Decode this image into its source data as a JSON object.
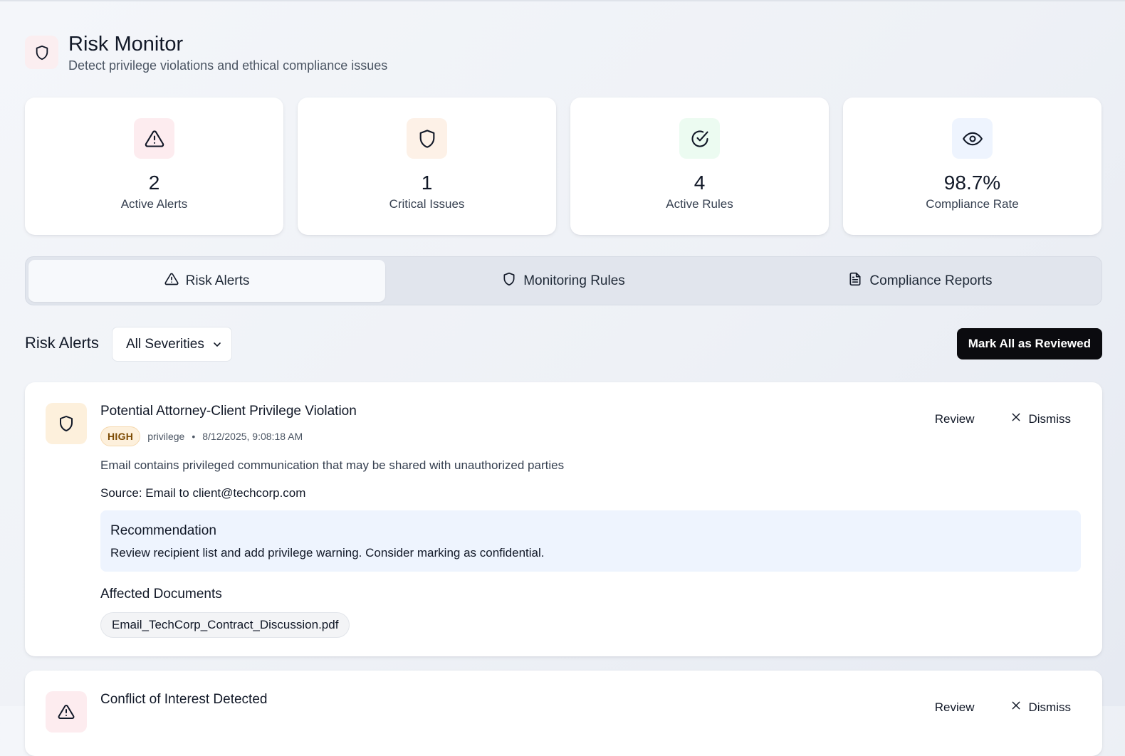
{
  "header": {
    "title": "Risk Monitor",
    "subtitle": "Detect privilege violations and ethical compliance issues",
    "icon": "shield-icon"
  },
  "stats": [
    {
      "value": "2",
      "label": "Active Alerts",
      "icon": "alert-triangle-icon",
      "bg": "#fdecef"
    },
    {
      "value": "1",
      "label": "Critical Issues",
      "icon": "shield-icon",
      "bg": "#fdf1e7"
    },
    {
      "value": "4",
      "label": "Active Rules",
      "icon": "check-circle-icon",
      "bg": "#ecfbf1"
    },
    {
      "value": "98.7%",
      "label": "Compliance Rate",
      "icon": "eye-icon",
      "bg": "#eef4fe"
    }
  ],
  "tabs": [
    {
      "label": "Risk Alerts",
      "icon": "alert-triangle-icon",
      "active": true
    },
    {
      "label": "Monitoring Rules",
      "icon": "shield-icon",
      "active": false
    },
    {
      "label": "Compliance Reports",
      "icon": "file-text-icon",
      "active": false
    }
  ],
  "toolbar": {
    "section_title": "Risk Alerts",
    "severity_selected": "All Severities",
    "mark_all_label": "Mark All as Reviewed"
  },
  "alerts": [
    {
      "title": "Potential Attorney-Client Privilege Violation",
      "severity": "HIGH",
      "category": "privilege",
      "separator": "•",
      "timestamp": "8/12/2025, 9:08:18 AM",
      "description": "Email contains privileged communication that may be shared with unauthorized parties",
      "source": "Source: Email to client@techcorp.com",
      "recommendation_title": "Recommendation",
      "recommendation_text": "Review recipient list and add privilege warning. Consider marking as confidential.",
      "affected_title": "Affected Documents",
      "documents": [
        "Email_TechCorp_Contract_Discussion.pdf"
      ],
      "review_label": "Review",
      "dismiss_label": "Dismiss"
    },
    {
      "title": "Conflict of Interest Detected",
      "review_label": "Review",
      "dismiss_label": "Dismiss"
    }
  ],
  "colors": {
    "accent_dark": "#0b0b0f",
    "high_badge_bg": "#fdf0dc",
    "recommend_bg": "#eef4fe"
  }
}
